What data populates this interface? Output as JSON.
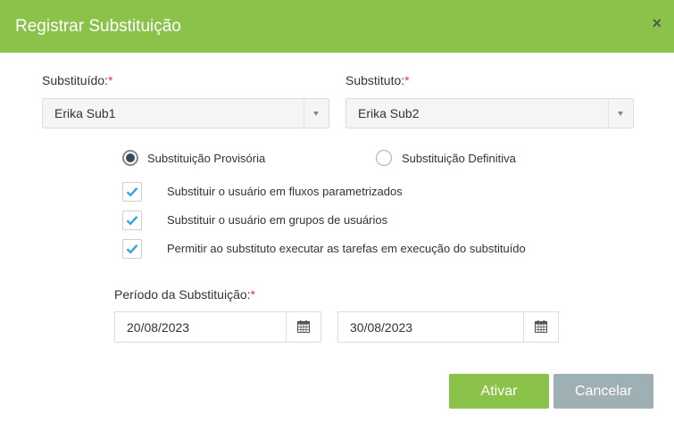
{
  "dialog": {
    "title": "Registrar Substituição",
    "close_glyph": "×"
  },
  "substituido": {
    "label": "Substituído:",
    "required": "*",
    "value": "Erika Sub1"
  },
  "substituto": {
    "label": "Substituto:",
    "required": "*",
    "value": "Erika Sub2"
  },
  "tipo": {
    "options": [
      {
        "label": "Substituição Provisória",
        "checked": true
      },
      {
        "label": "Substituição Definitiva",
        "checked": false
      }
    ]
  },
  "opcoes": [
    {
      "label": "Substituir o usuário em fluxos parametrizados",
      "checked": true
    },
    {
      "label": "Substituir o usuário em grupos de usuários",
      "checked": true
    },
    {
      "label": "Permitir ao substituto executar as tarefas em execução do substituído",
      "checked": true
    }
  ],
  "periodo": {
    "label": "Período da Substituição:",
    "required": "*",
    "inicio": "20/08/2023",
    "fim": "30/08/2023"
  },
  "buttons": {
    "ok": "Ativar",
    "cancel": "Cancelar"
  },
  "colors": {
    "header": "#8bc34a",
    "check": "#29a8e0",
    "cancel": "#9fb0b5"
  },
  "icons": [
    "close-icon",
    "chevron-down-icon",
    "check-icon",
    "calendar-icon"
  ]
}
